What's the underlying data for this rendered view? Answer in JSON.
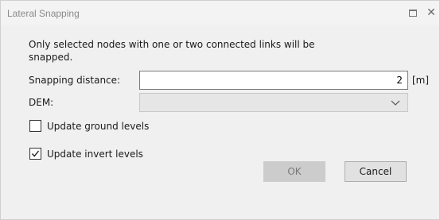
{
  "window": {
    "title": "Lateral Snapping",
    "restore_icon": "restore-icon",
    "close_glyph": "✕"
  },
  "description": {
    "line1": "Only selected nodes with one or two connected links will be",
    "line2": "snapped."
  },
  "snapping": {
    "label": "Snapping distance:",
    "value": "2",
    "unit": "[m]"
  },
  "dem": {
    "label": "DEM:",
    "selected_value": "",
    "disabled": true
  },
  "options": {
    "update_ground_levels": {
      "label": "Update ground levels",
      "checked": false
    },
    "update_invert_levels": {
      "label": "Update invert levels",
      "checked": true
    }
  },
  "buttons": {
    "ok_label": "OK",
    "cancel_label": "Cancel"
  },
  "colors": {
    "background": "#f0f0f0",
    "input_border": "#7a7a7a",
    "disabled_fill": "#e6e6e6",
    "title_text": "#8a8a8a"
  }
}
